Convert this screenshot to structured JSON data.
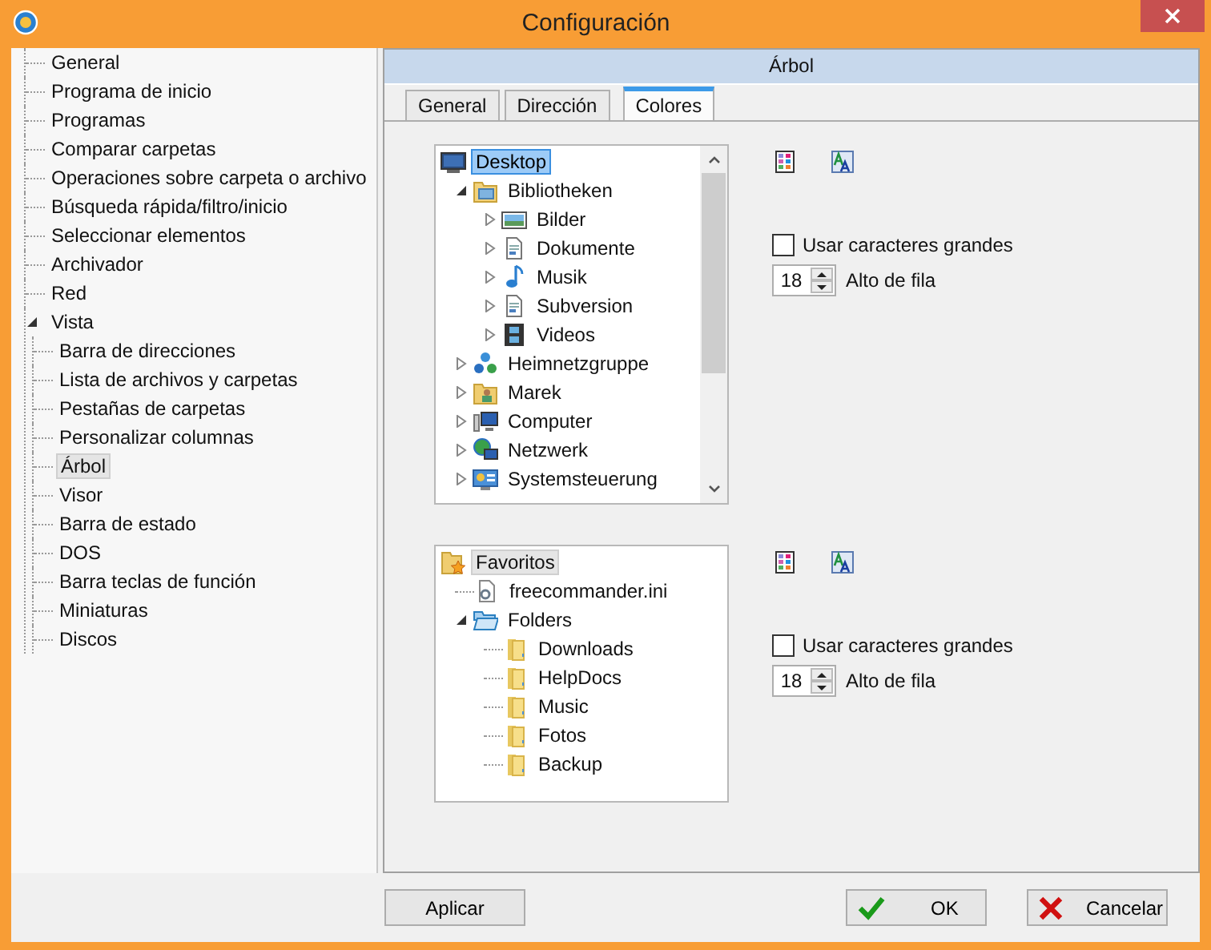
{
  "window": {
    "title": "Configuración"
  },
  "sidebar": {
    "items": [
      {
        "label": "General",
        "selected": false
      },
      {
        "label": "Programa de inicio",
        "selected": false
      },
      {
        "label": "Programas",
        "selected": false
      },
      {
        "label": "Comparar carpetas",
        "selected": false
      },
      {
        "label": "Operaciones sobre carpeta o archivo",
        "selected": false
      },
      {
        "label": "Búsqueda rápida/filtro/inicio",
        "selected": false
      },
      {
        "label": "Seleccionar elementos",
        "selected": false
      },
      {
        "label": "Archivador",
        "selected": false
      },
      {
        "label": "Red",
        "selected": false
      },
      {
        "label": "Vista",
        "selected": false,
        "expanded": true,
        "children": [
          {
            "label": "Barra de direcciones",
            "selected": false
          },
          {
            "label": "Lista de archivos y carpetas",
            "selected": false
          },
          {
            "label": "Pestañas de carpetas",
            "selected": false
          },
          {
            "label": "Personalizar columnas",
            "selected": false
          },
          {
            "label": "Árbol",
            "selected": true
          },
          {
            "label": "Visor",
            "selected": false
          },
          {
            "label": "Barra de estado",
            "selected": false
          },
          {
            "label": "DOS",
            "selected": false
          },
          {
            "label": "Barra teclas de función",
            "selected": false
          },
          {
            "label": "Miniaturas",
            "selected": false
          },
          {
            "label": "Discos",
            "selected": false
          }
        ]
      }
    ]
  },
  "panel": {
    "title": "Árbol",
    "tabs": [
      {
        "label": "General",
        "selected": false
      },
      {
        "label": "Dirección",
        "selected": false
      },
      {
        "label": "Colores",
        "selected": true
      }
    ],
    "sections": [
      {
        "tree": {
          "active": true,
          "scrollbar": true,
          "nodes": [
            {
              "label": "Desktop",
              "kind": "monitor",
              "selected": true,
              "children": [
                {
                  "label": "Bibliotheken",
                  "kind": "library",
                  "selected": false,
                  "expanded": true,
                  "children": [
                    {
                      "label": "Bilder",
                      "kind": "picture",
                      "selected": false,
                      "expanded": false
                    },
                    {
                      "label": "Dokumente",
                      "kind": "document",
                      "selected": false,
                      "expanded": false
                    },
                    {
                      "label": "Musik",
                      "kind": "music",
                      "selected": false,
                      "expanded": false
                    },
                    {
                      "label": "Subversion",
                      "kind": "document",
                      "selected": false,
                      "expanded": false
                    },
                    {
                      "label": "Videos",
                      "kind": "film",
                      "selected": false,
                      "expanded": false
                    }
                  ]
                },
                {
                  "label": "Heimnetzgruppe",
                  "kind": "network",
                  "selected": false,
                  "expanded": false
                },
                {
                  "label": "Marek",
                  "kind": "user",
                  "selected": false,
                  "expanded": false
                },
                {
                  "label": "Computer",
                  "kind": "computer",
                  "selected": false,
                  "expanded": false
                },
                {
                  "label": "Netzwerk",
                  "kind": "globe",
                  "selected": false,
                  "expanded": false
                },
                {
                  "label": "Systemsteuerung",
                  "kind": "panel",
                  "selected": false,
                  "expanded": false
                }
              ]
            }
          ]
        },
        "checkbox": {
          "label": "Usar caracteres grandes",
          "checked": false
        },
        "spinner": {
          "value": "18",
          "label": "Alto de fila"
        }
      },
      {
        "tree": {
          "active": false,
          "scrollbar": false,
          "nodes": [
            {
              "label": "Favoritos",
              "kind": "star",
              "selected": true,
              "children": [
                {
                  "label": "freecommander.ini",
                  "kind": "settings",
                  "selected": false
                },
                {
                  "label": "Folders",
                  "kind": "openfolder",
                  "selected": false,
                  "expanded": true,
                  "children": [
                    {
                      "label": "Downloads",
                      "kind": "folder",
                      "selected": false
                    },
                    {
                      "label": "HelpDocs",
                      "kind": "folder",
                      "selected": false
                    },
                    {
                      "label": "Music",
                      "kind": "folder",
                      "selected": false
                    },
                    {
                      "label": "Fotos",
                      "kind": "folder",
                      "selected": false
                    },
                    {
                      "label": "Backup",
                      "kind": "folder",
                      "selected": false
                    }
                  ]
                }
              ]
            }
          ]
        },
        "checkbox": {
          "label": "Usar caracteres grandes",
          "checked": false
        },
        "spinner": {
          "value": "18",
          "label": "Alto de fila"
        }
      }
    ]
  },
  "buttons": [
    {
      "label": "Aplicar",
      "kind": "plain"
    },
    {
      "label": "OK",
      "kind": "ok"
    },
    {
      "label": "Cancelar",
      "kind": "cancel"
    }
  ]
}
